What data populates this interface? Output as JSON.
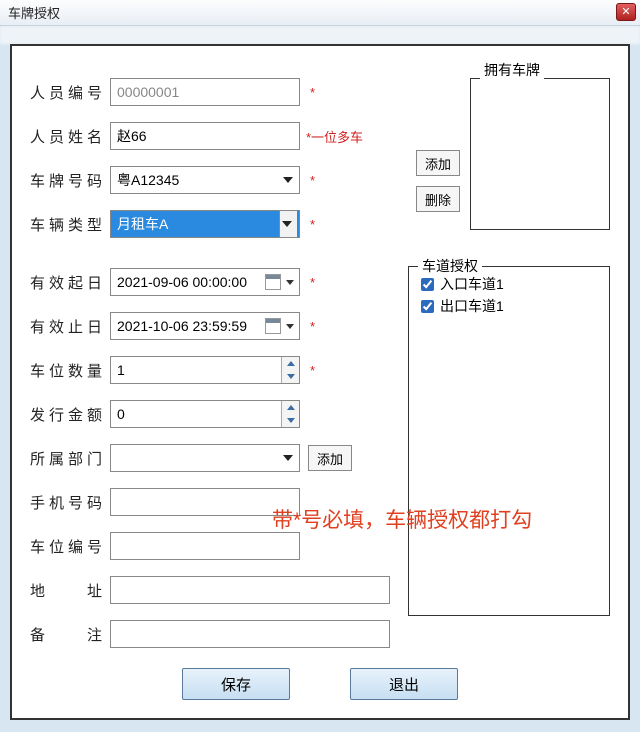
{
  "window": {
    "title": "车牌授权",
    "close": "✕"
  },
  "labels": {
    "person_id": "人员编号",
    "person_name": "人员姓名",
    "plate_no": "车牌号码",
    "vehicle_type": "车辆类型",
    "valid_from": "有效起日",
    "valid_to": "有效止日",
    "space_count": "车位数量",
    "issue_amount": "发行金额",
    "department": "所属部门",
    "phone": "手机号码",
    "space_id": "车位编号",
    "address": "地　址",
    "remark": "备　注"
  },
  "values": {
    "person_id": "00000001",
    "person_name": "赵66",
    "plate_no": "粤A12345",
    "vehicle_type": "月租车A",
    "valid_from": "2021-09-06 00:00:00",
    "valid_to": "2021-10-06 23:59:59",
    "space_count": "1",
    "issue_amount": "0",
    "department": "",
    "phone": "",
    "space_id": "",
    "address": "",
    "remark": ""
  },
  "marks": {
    "star": "*",
    "one_many": "*一位多车"
  },
  "buttons": {
    "add": "添加",
    "delete": "删除",
    "add2": "添加",
    "save": "保存",
    "exit": "退出"
  },
  "groups": {
    "owned": "拥有车牌",
    "lane": "车道授权"
  },
  "lanes": [
    {
      "label": "入口车道1",
      "checked": true
    },
    {
      "label": "出口车道1",
      "checked": true
    }
  ],
  "annotation": "带*号必填，车辆授权都打勾"
}
